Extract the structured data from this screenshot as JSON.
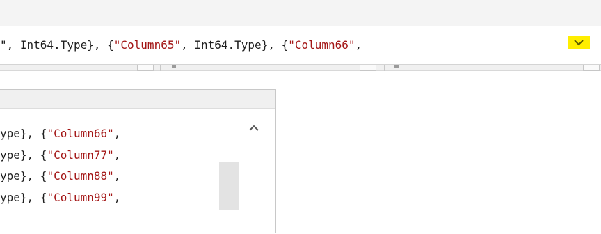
{
  "formula_bar": {
    "pre": "\", Int64.Type}, {",
    "str1": "\"Column65\"",
    "mid": ", Int64.Type}, {",
    "str2": "\"Column66\"",
    "post": ","
  },
  "expand_icon": "chevron-down-icon",
  "popup": {
    "lines": [
      {
        "pre": "ype}, {",
        "str": "\"Column66\"",
        "post": ","
      },
      {
        "pre": "ype}, {",
        "str": "\"Column77\"",
        "post": ","
      },
      {
        "pre": "ype}, {",
        "str": "\"Column88\"",
        "post": ","
      },
      {
        "pre": "ype}, {",
        "str": "\"Column99\"",
        "post": ","
      }
    ],
    "scroll_up_icon": "chevron-up-icon"
  },
  "colors": {
    "accent_highlight": "#ffee00",
    "string_literal": "#a31515"
  }
}
